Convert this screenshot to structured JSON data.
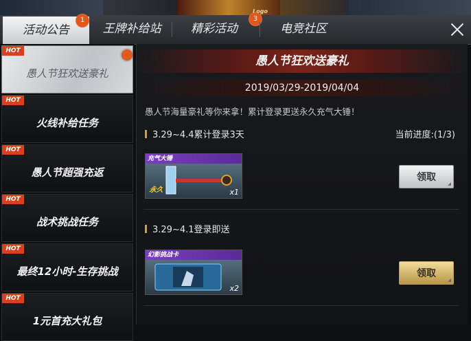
{
  "tabs": [
    {
      "label": "活动公告",
      "badge": "1",
      "active": true
    },
    {
      "label": "王牌补给站",
      "badge": "",
      "active": false
    },
    {
      "label": "精彩活动",
      "badge": "3",
      "active": false
    },
    {
      "label": "电竞社区",
      "badge": "",
      "active": false
    }
  ],
  "sidebar": {
    "hot_label": "HOT",
    "items": [
      {
        "label": "愚人节狂欢送豪礼",
        "active": true
      },
      {
        "label": "火线补给任务",
        "active": false
      },
      {
        "label": "愚人节超强充返",
        "active": false
      },
      {
        "label": "战术挑战任务",
        "active": false
      },
      {
        "label": "最终12小时-生存挑战",
        "active": false
      },
      {
        "label": "1元首充大礼包",
        "active": false
      }
    ]
  },
  "panel": {
    "title": "愚人节狂欢送豪礼",
    "date_range": "2019/03/29-2019/04/04",
    "description": "愚人节海量豪礼等你来拿！累计登录更送永久充气大锤！",
    "progress_label": "当前进度:(1/3)",
    "rewards": [
      {
        "condition": "3.29~4.4累计登录3天",
        "item_name": "充气大锤",
        "item_tag": "永久",
        "quantity": "x1",
        "button": "领取",
        "button_style": "silver"
      },
      {
        "condition": "3.29~4.1登录即送",
        "item_name": "幻影挑战卡",
        "item_tag": "",
        "quantity": "x2",
        "button": "领取",
        "button_style": "gold"
      }
    ]
  },
  "colors": {
    "accent": "#e2571c",
    "hot": "#d8401e",
    "gold": "#d4a22c"
  },
  "icons": {
    "close": "close-icon",
    "notification_dot": "notification-dot"
  }
}
